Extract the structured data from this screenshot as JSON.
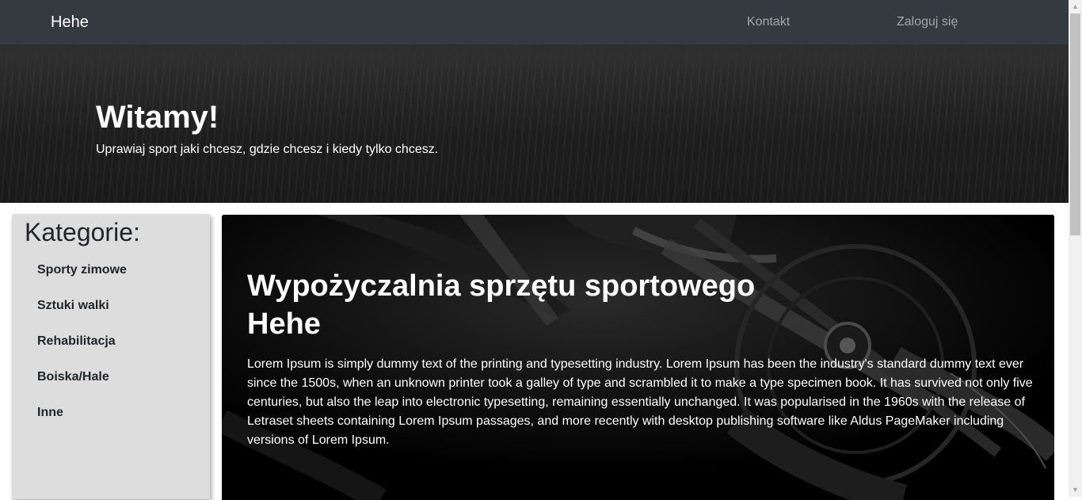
{
  "navbar": {
    "brand": "Hehe",
    "links": [
      "Kontakt",
      "Zaloguj się"
    ]
  },
  "hero": {
    "title": "Witamy!",
    "subtitle": "Uprawiaj sport jaki chcesz, gdzie chcesz i kiedy tylko chcesz."
  },
  "sidebar": {
    "title": "Kategorie:",
    "items": [
      "Sporty zimowe",
      "Sztuki walki",
      "Rehabilitacja",
      "Boiska/Hale",
      "Inne"
    ]
  },
  "main": {
    "title_line1": "Wypożyczalnia sprzętu sportowego",
    "title_line2": "Hehe",
    "text": "Lorem Ipsum is simply dummy text of the printing and typesetting industry. Lorem Ipsum has been the industry's standard dummy text ever since the 1500s, when an unknown printer took a galley of type and scrambled it to make a type specimen book. It has survived not only five centuries, but also the leap into electronic typesetting, remaining essentially unchanged. It was popularised in the 1960s with the release of Letraset sheets containing Lorem Ipsum passages, and more recently with desktop publishing software like Aldus PageMaker including versions of Lorem Ipsum."
  },
  "colors": {
    "navbar_bg": "#343a40",
    "sidebar_bg": "#dddddd",
    "card_bg": "#000000"
  },
  "icons": {
    "scroll_up": "triangle-up-icon",
    "scroll_down": "triangle-down-icon"
  }
}
